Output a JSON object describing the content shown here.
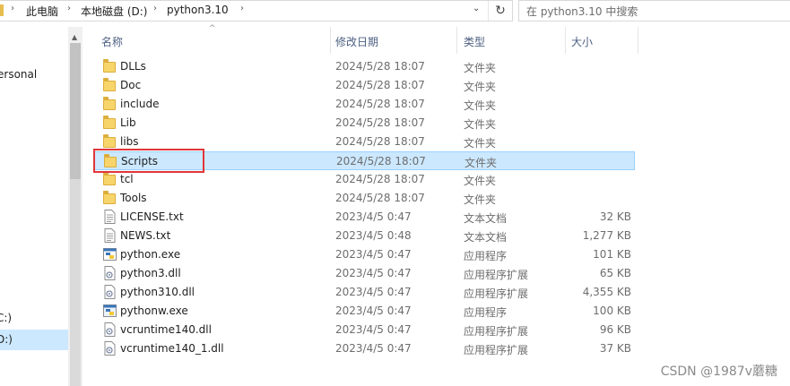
{
  "address": {
    "crumbs": [
      "此电脑",
      "本地磁盘 (D:)",
      "python3.10"
    ],
    "separator": "›",
    "dropdown": "⌄",
    "refresh": "↻"
  },
  "search": {
    "placeholder": "在 python3.10 中搜索"
  },
  "nav": {
    "items": [
      {
        "label": "ersonal"
      },
      {
        "label": "C:)"
      },
      {
        "label": "D:)"
      },
      {
        "label": ")"
      }
    ]
  },
  "columns": {
    "name": "名称",
    "date": "修改日期",
    "type": "类型",
    "size": "大小",
    "sort_indicator": "^"
  },
  "files": [
    {
      "name": "DLLs",
      "date": "2024/5/28 18:07",
      "type": "文件夹",
      "size": "",
      "icon": "folder-icon"
    },
    {
      "name": "Doc",
      "date": "2024/5/28 18:07",
      "type": "文件夹",
      "size": "",
      "icon": "folder-icon"
    },
    {
      "name": "include",
      "date": "2024/5/28 18:07",
      "type": "文件夹",
      "size": "",
      "icon": "folder-icon"
    },
    {
      "name": "Lib",
      "date": "2024/5/28 18:07",
      "type": "文件夹",
      "size": "",
      "icon": "folder-icon"
    },
    {
      "name": "libs",
      "date": "2024/5/28 18:07",
      "type": "文件夹",
      "size": "",
      "icon": "folder-icon"
    },
    {
      "name": "Scripts",
      "date": "2024/5/28 18:07",
      "type": "文件夹",
      "size": "",
      "icon": "folder-icon",
      "selected": true
    },
    {
      "name": "tcl",
      "date": "2024/5/28 18:07",
      "type": "文件夹",
      "size": "",
      "icon": "folder-icon"
    },
    {
      "name": "Tools",
      "date": "2024/5/28 18:07",
      "type": "文件夹",
      "size": "",
      "icon": "folder-icon"
    },
    {
      "name": "LICENSE.txt",
      "date": "2023/4/5 0:47",
      "type": "文本文档",
      "size": "32 KB",
      "icon": "text-file-icon"
    },
    {
      "name": "NEWS.txt",
      "date": "2023/4/5 0:48",
      "type": "文本文档",
      "size": "1,277 KB",
      "icon": "text-file-icon"
    },
    {
      "name": "python.exe",
      "date": "2023/4/5 0:47",
      "type": "应用程序",
      "size": "101 KB",
      "icon": "python-exe-icon"
    },
    {
      "name": "python3.dll",
      "date": "2023/4/5 0:47",
      "type": "应用程序扩展",
      "size": "65 KB",
      "icon": "dll-file-icon"
    },
    {
      "name": "python310.dll",
      "date": "2023/4/5 0:47",
      "type": "应用程序扩展",
      "size": "4,355 KB",
      "icon": "dll-file-icon"
    },
    {
      "name": "pythonw.exe",
      "date": "2023/4/5 0:47",
      "type": "应用程序",
      "size": "100 KB",
      "icon": "pythonw-exe-icon"
    },
    {
      "name": "vcruntime140.dll",
      "date": "2023/4/5 0:47",
      "type": "应用程序扩展",
      "size": "96 KB",
      "icon": "dll-file-icon"
    },
    {
      "name": "vcruntime140_1.dll",
      "date": "2023/4/5 0:47",
      "type": "应用程序扩展",
      "size": "37 KB",
      "icon": "dll-file-icon"
    }
  ],
  "colors": {
    "selection": "#cce8ff",
    "selection_border": "#99d1ff",
    "highlight_box": "#e0363a",
    "folder": "#f7d56b"
  },
  "watermark": "CSDN @1987v蘑糖"
}
